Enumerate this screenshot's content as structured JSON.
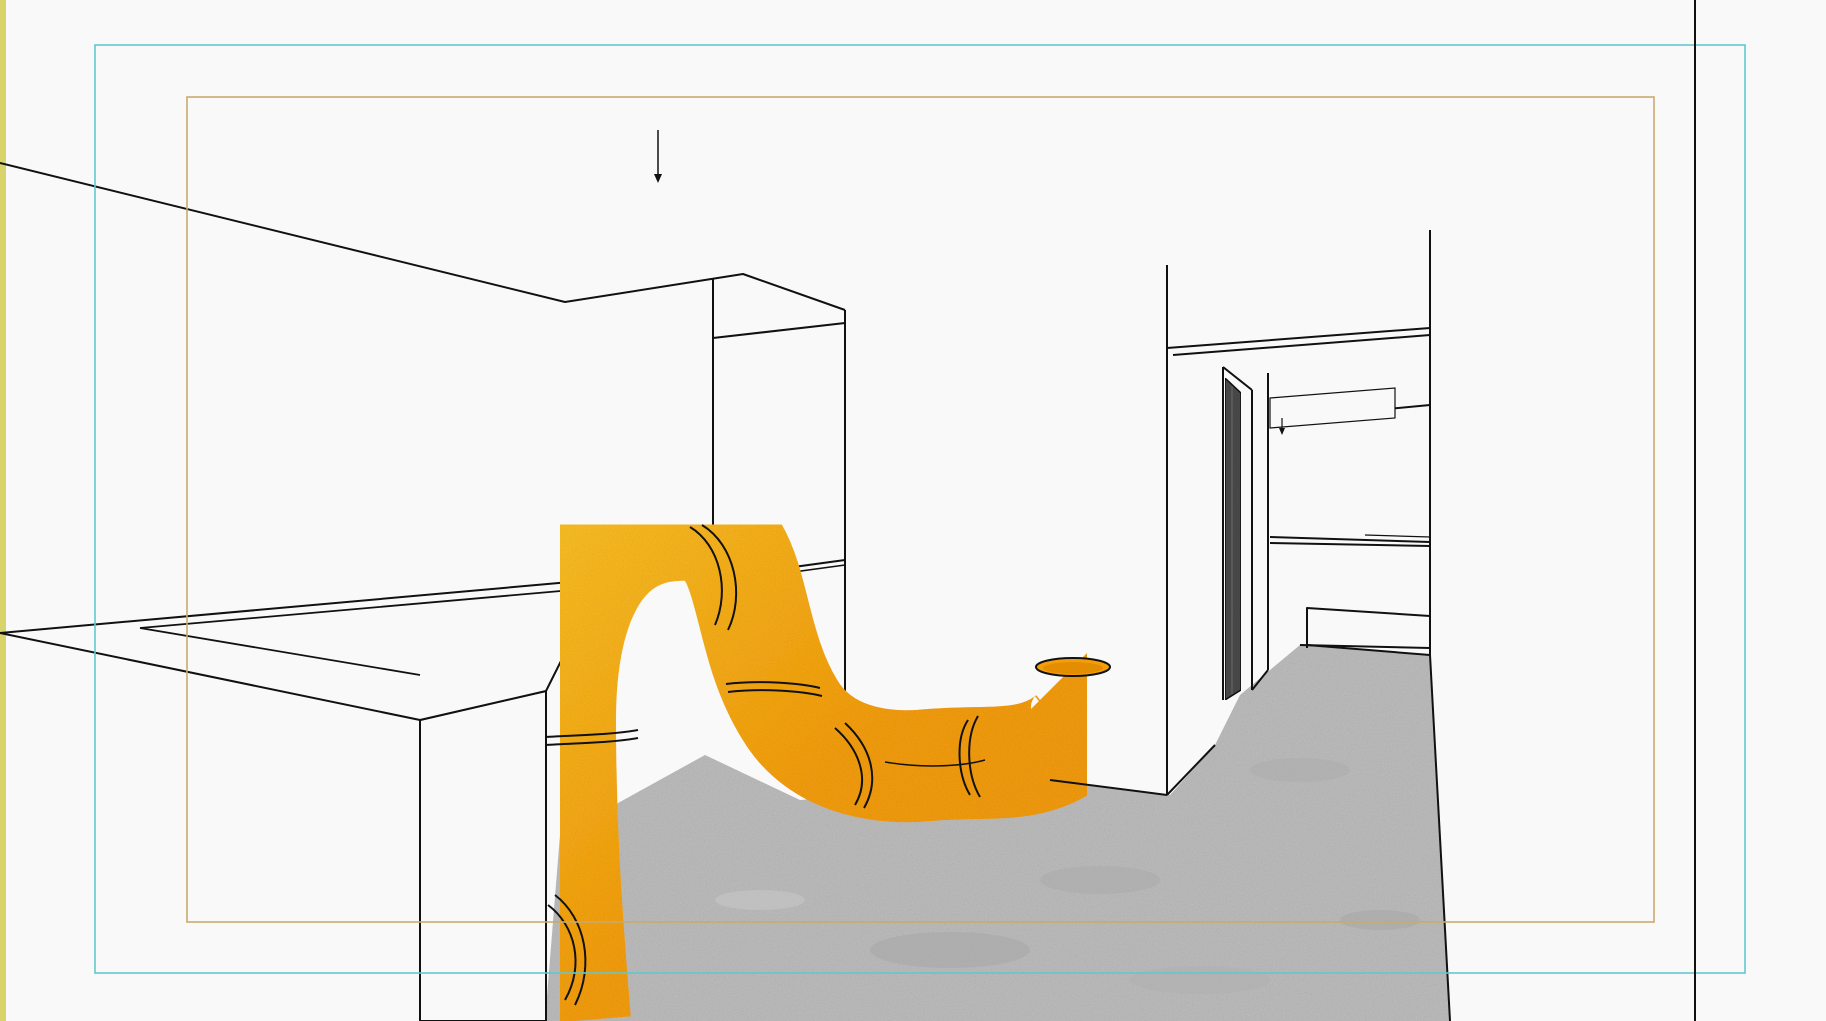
{
  "canvas": {
    "background_color": "#f9f9f9",
    "line_color": "#111111",
    "pipe_color": "#f59e0b",
    "pipe_highlight_color": "#fbbf24",
    "floor_color": "#bdbdbd",
    "action_safe_guide_color": "#5fc9cf",
    "title_safe_guide_color": "#c8aa6e",
    "left_edge_color": "#d8d36a"
  },
  "elements": {
    "pipe": "orange-segmented-pipe",
    "floor": "concrete-floor",
    "door": "dark-wood-door",
    "guides": [
      "action-safe-guide",
      "title-safe-guide"
    ],
    "arrows": [
      "camera-arrow-top",
      "camera-arrow-room"
    ]
  }
}
